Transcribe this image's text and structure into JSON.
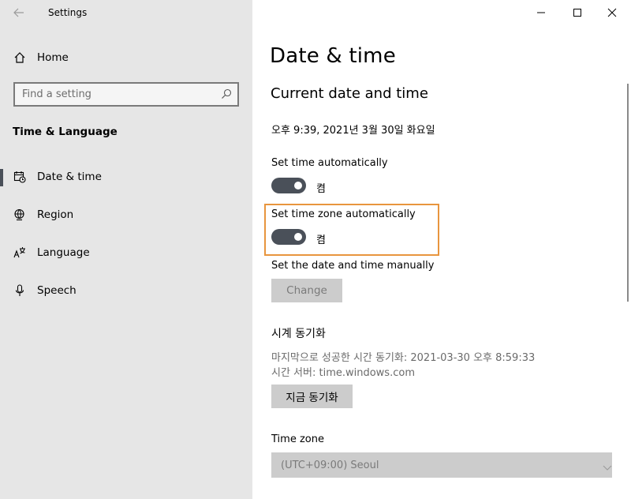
{
  "window": {
    "app_title": "Settings"
  },
  "sidebar": {
    "home_label": "Home",
    "search": {
      "placeholder": "Find a setting"
    },
    "section_heading": "Time & Language",
    "items": [
      {
        "label": "Date & time",
        "icon": "date-time-icon",
        "active": true
      },
      {
        "label": "Region",
        "icon": "globe-icon",
        "active": false
      },
      {
        "label": "Language",
        "icon": "language-icon",
        "active": false
      },
      {
        "label": "Speech",
        "icon": "microphone-icon",
        "active": false
      }
    ]
  },
  "main": {
    "title": "Date & time",
    "section_title": "Current date and time",
    "current_datetime": "오후 9:39, 2021년 3월 30일 화요일",
    "set_time_auto": {
      "label": "Set time automatically",
      "state": "켬"
    },
    "set_timezone_auto": {
      "label": "Set time zone automatically",
      "state": "켬"
    },
    "manual": {
      "label": "Set the date and time manually",
      "button": "Change"
    },
    "sync": {
      "title": "시계 동기화",
      "last_sync": "마지막으로 성공한 시간 동기화: 2021-03-30 오후 8:59:33",
      "server": "시간 서버: time.windows.com",
      "button": "지금 동기화"
    },
    "timezone": {
      "label": "Time zone",
      "value": "(UTC+09:00) Seoul"
    }
  },
  "colors": {
    "sidebar_bg": "#e6e6e6",
    "toggle_on": "#4a5059",
    "highlight": "#e8953e",
    "button_bg": "#cccccc"
  }
}
